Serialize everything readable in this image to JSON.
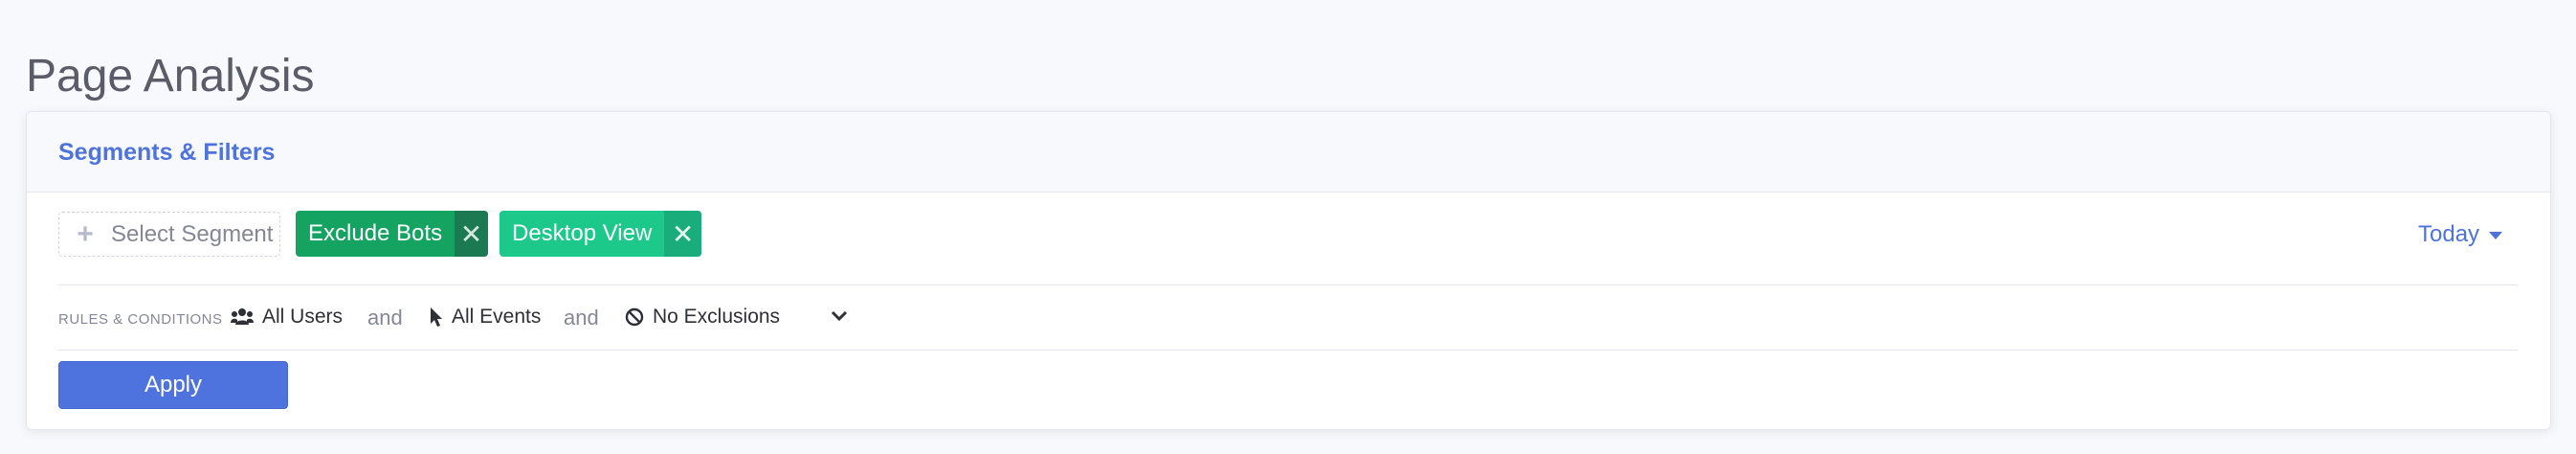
{
  "page": {
    "title": "Page Analysis"
  },
  "card": {
    "title": "Segments & Filters",
    "segment_select": {
      "placeholder": "Select Segment"
    },
    "chips": [
      {
        "label": "Exclude Bots",
        "color": "#15a362"
      },
      {
        "label": "Desktop View",
        "color": "#1cc88a"
      }
    ],
    "date_range": {
      "label": "Today"
    },
    "rules": {
      "label": "RULES & CONDITIONS",
      "conditions": [
        {
          "label": "All Users",
          "icon": "users-icon"
        },
        {
          "label": "All Events",
          "icon": "cursor-icon"
        },
        {
          "label": "No Exclusions",
          "icon": "ban-icon"
        }
      ],
      "connector": "and"
    },
    "apply_label": "Apply"
  },
  "colors": {
    "primary": "#4e73df",
    "success_dark": "#15a362",
    "success": "#1cc88a"
  }
}
